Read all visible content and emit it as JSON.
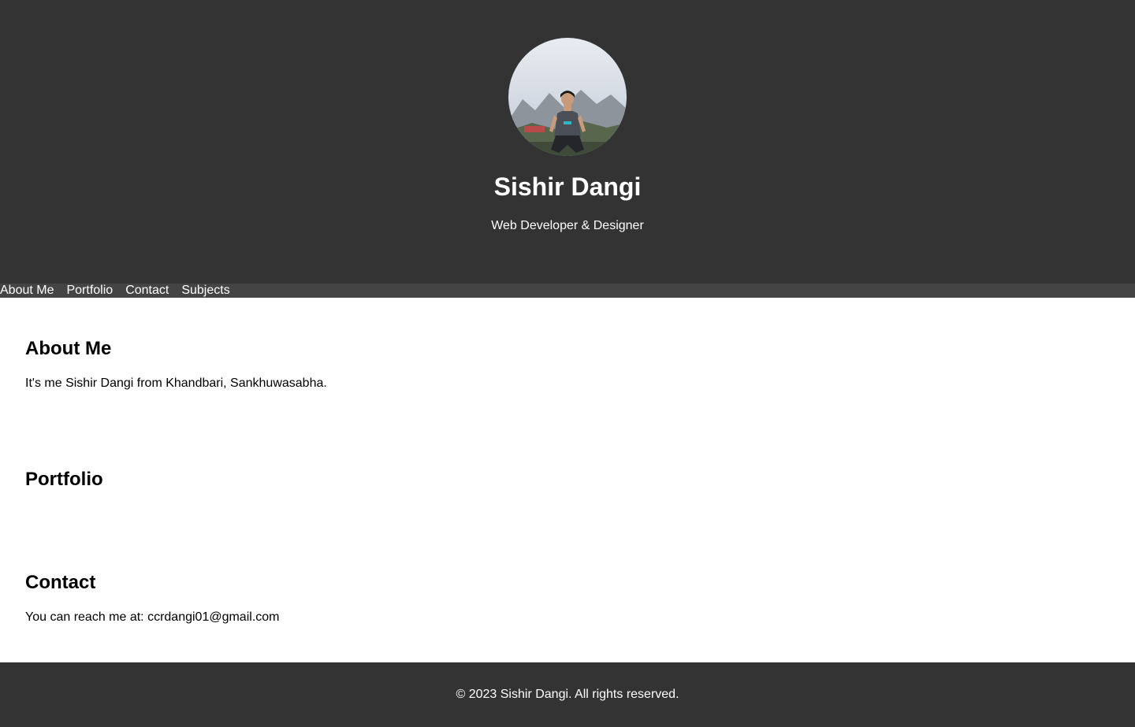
{
  "header": {
    "name": "Sishir Dangi",
    "tagline": "Web Developer & Designer",
    "avatar_icon": "profile-photo"
  },
  "nav": {
    "items": [
      {
        "label": "About Me"
      },
      {
        "label": "Portfolio"
      },
      {
        "label": "Contact"
      },
      {
        "label": "Subjects"
      }
    ]
  },
  "sections": {
    "about": {
      "title": "About Me",
      "text": "It's me Sishir Dangi from Khandbari, Sankhuwasabha."
    },
    "portfolio": {
      "title": "Portfolio"
    },
    "contact": {
      "title": "Contact",
      "text": "You can reach me at: ccrdangi01@gmail.com"
    }
  },
  "footer": {
    "copyright": "© 2023 Sishir Dangi. All rights reserved."
  },
  "colors": {
    "header_bg": "#333333",
    "nav_bg": "#444444",
    "footer_bg": "#333333",
    "content_bg": "#ffffff",
    "header_text": "#ffffff"
  }
}
